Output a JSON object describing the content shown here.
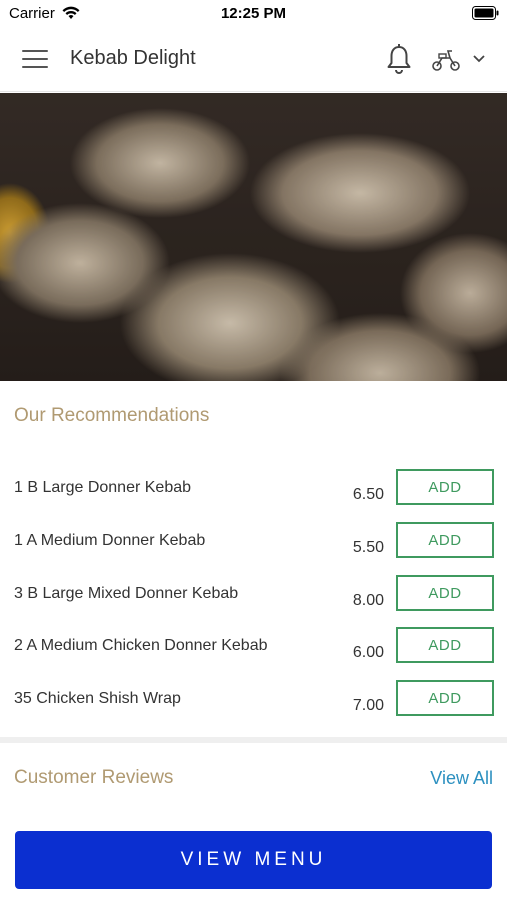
{
  "status_bar": {
    "carrier": "Carrier",
    "time": "12:25 PM"
  },
  "header": {
    "title": "Kebab Delight"
  },
  "recommendations": {
    "title": "Our Recommendations",
    "add_label": "ADD",
    "items": [
      {
        "name": "1 B Large Donner Kebab",
        "price": "6.50"
      },
      {
        "name": "1 A Medium Donner Kebab",
        "price": "5.50"
      },
      {
        "name": "3 B Large Mixed Donner Kebab",
        "price": "8.00"
      },
      {
        "name": "2 A Medium Chicken Donner Kebab",
        "price": "6.00"
      },
      {
        "name": "35 Chicken Shish Wrap",
        "price": "7.00"
      }
    ]
  },
  "reviews": {
    "title": "Customer Reviews",
    "view_all": "View All"
  },
  "footer": {
    "view_menu": "VIEW MENU"
  },
  "colors": {
    "accent_gold": "#b09a72",
    "add_green": "#3f9a5f",
    "link_blue": "#2c90c0",
    "cta_blue": "#0b2fd0"
  },
  "icons": [
    "wifi-icon",
    "battery-icon",
    "menu-icon",
    "bell-icon",
    "scooter-icon",
    "chevron-down-icon"
  ]
}
